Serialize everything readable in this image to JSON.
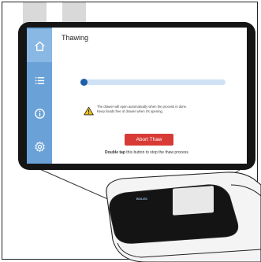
{
  "app": {
    "title": "Thawing"
  },
  "sidebar": {
    "items": [
      {
        "icon": "home-icon"
      },
      {
        "icon": "list-icon"
      },
      {
        "icon": "info-icon"
      },
      {
        "icon": "gear-icon"
      }
    ]
  },
  "progress": {
    "value": 0.0
  },
  "warning": {
    "icon": "warning-icon",
    "line1": "The drawer will open automatically when the process is done.",
    "line2": "Keep hands free of drawer when it's opening."
  },
  "abort_button": {
    "label": "Abort Thaw"
  },
  "hint": {
    "bold": "Double tap",
    "rest": " this button to stop the thaw process"
  },
  "device": {
    "brand": "BOLES"
  },
  "colors": {
    "sidebar": "#6aa2d8",
    "accent": "#1f5fa8",
    "abort": "#d83a35"
  }
}
